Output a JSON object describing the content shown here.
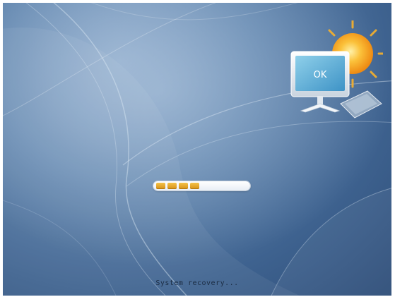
{
  "status": {
    "message": "System recovery..."
  },
  "monitor": {
    "screen_text": "OK"
  },
  "progress": {
    "value_fraction": 0.48,
    "blocks_filled": 4
  },
  "colors": {
    "background": "#4a6e98",
    "progress_block": "#e6a82a",
    "progress_track": "#ffffff",
    "sun": "#f7a21b"
  },
  "icons": [
    "sun-icon",
    "monitor-icon",
    "keyboard-icon"
  ]
}
